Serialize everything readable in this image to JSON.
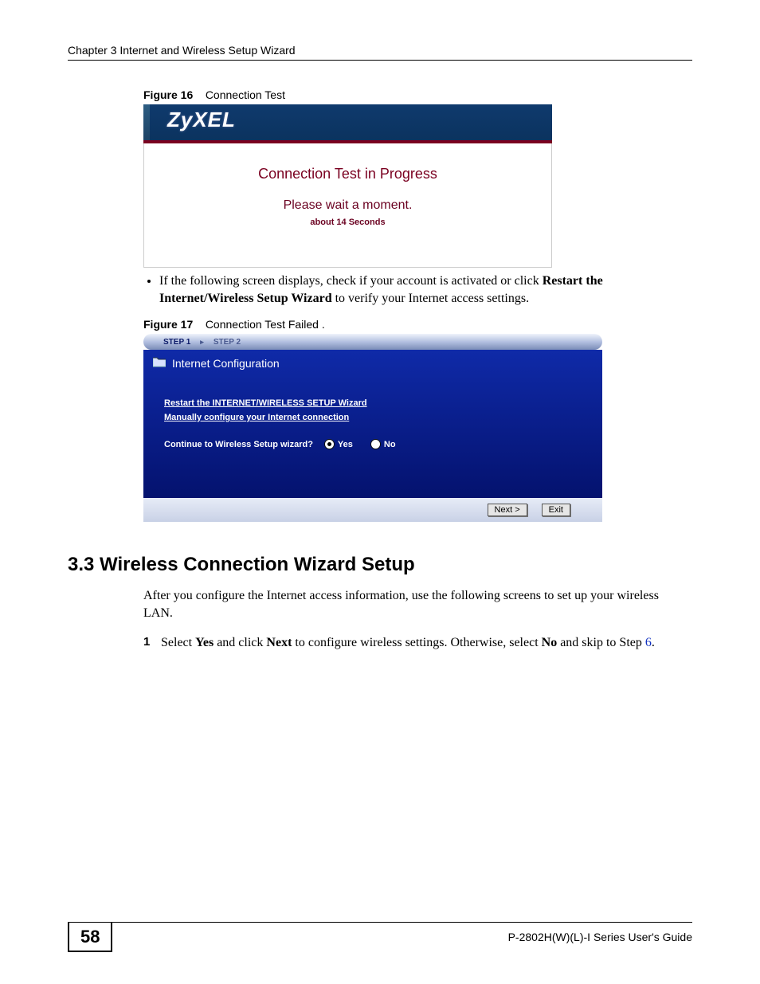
{
  "header": {
    "chapter": "Chapter 3 Internet and Wireless Setup Wizard"
  },
  "fig16": {
    "label": "Figure 16",
    "caption": "Connection Test",
    "logo": "ZyXEL",
    "title": "Connection Test in Progress",
    "wait": "Please wait a moment.",
    "seconds": "about 14 Seconds"
  },
  "bullet_text": {
    "pre": "If the following screen displays, check if your account is activated or click ",
    "bold": "Restart the Internet/Wireless Setup Wizard",
    "post": " to verify your Internet access settings."
  },
  "fig17": {
    "label": "Figure 17",
    "caption": "Connection Test Failed .",
    "step1": "STEP 1",
    "step2": "STEP 2",
    "panel_title": "Internet Configuration",
    "link1": "Restart the INTERNET/WIRELESS SETUP Wizard",
    "link2": "Manually configure your Internet connection",
    "continue_label": "Continue to Wireless Setup wizard?",
    "yes": "Yes",
    "no": "No",
    "next_btn": "Next >",
    "exit_btn": "Exit"
  },
  "section": {
    "title": "3.3  Wireless Connection Wizard Setup",
    "intro": "After you configure the Internet access information, use the following screens to set up your wireless LAN.",
    "step_num": "1",
    "step_pre": "Select ",
    "step_b1": "Yes",
    "step_mid1": " and click ",
    "step_b2": "Next",
    "step_mid2": " to configure wireless settings. Otherwise, select ",
    "step_b3": "No",
    "step_mid3": " and skip to Step ",
    "step_link": "6",
    "step_end": "."
  },
  "footer": {
    "page": "58",
    "guide": "P-2802H(W)(L)-I Series User's Guide"
  }
}
